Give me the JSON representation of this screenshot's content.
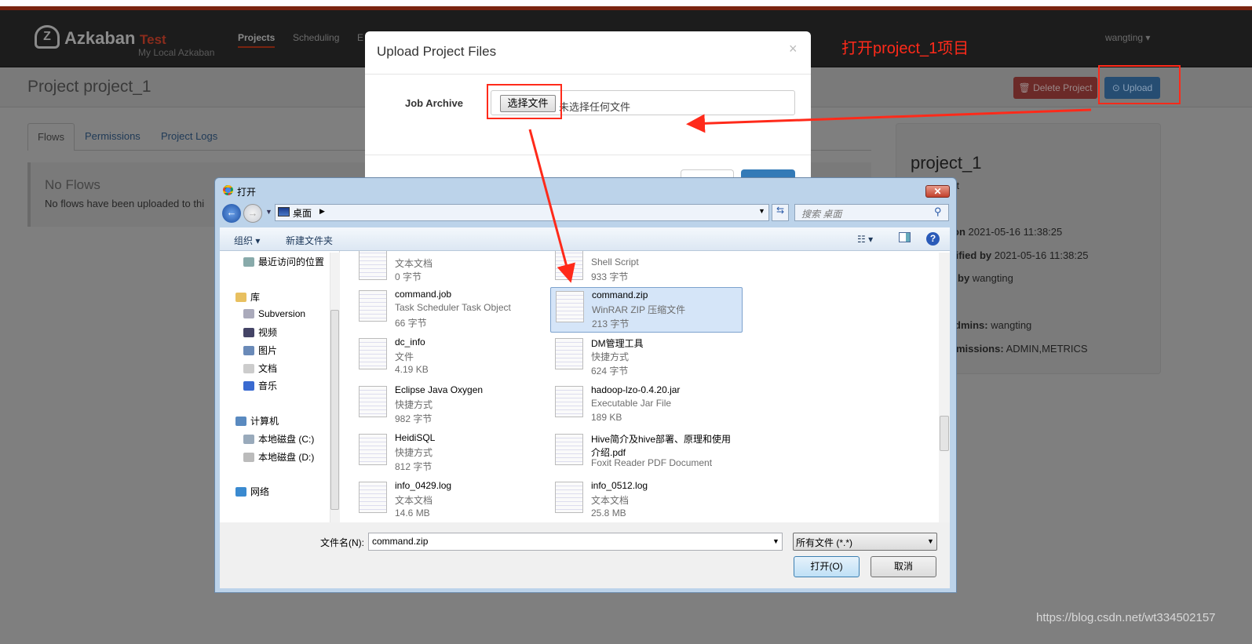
{
  "navbar": {
    "brand": "Azkaban",
    "env": "Test",
    "subtitle": "My Local Azkaban",
    "links": [
      "Projects",
      "Scheduling",
      "E"
    ],
    "user": "wangting"
  },
  "page": {
    "title": "Project project_1",
    "delete_label": "Delete Project",
    "upload_label": "Upload",
    "tabs": [
      "Flows",
      "Permissions",
      "Project Logs"
    ],
    "no_flows_title": "No Flows",
    "no_flows_text": "No flows have been uploaded to thi"
  },
  "sidebar": {
    "name": "project_1",
    "desc": "st",
    "lines": [
      {
        "k": "on",
        "v": " 2021-05-16 11:38:25"
      },
      {
        "k": "lified by",
        "v": " 2021-05-16 11:38:25"
      },
      {
        "k": "by",
        "v": " wangting"
      },
      {
        "k": "dmins:",
        "v": " wangting"
      },
      {
        "k": "missions:",
        "v": " ADMIN,METRICS"
      }
    ]
  },
  "modal": {
    "title": "Upload Project Files",
    "close": "×",
    "job_archive_label": "Job Archive",
    "choose_file": "选择文件",
    "no_file": "未选择任何文件"
  },
  "annotation": "打开project_1项目",
  "file_dialog": {
    "title": "打开",
    "close": "✕",
    "address": "桌面",
    "search_placeholder": "搜索 桌面",
    "toolbar": {
      "organize": "组织 ▾",
      "new_folder": "新建文件夹"
    },
    "nav": [
      {
        "label": "最近访问的位置",
        "color": "#8aa"
      },
      {
        "label": "库",
        "color": "#e8c060"
      },
      {
        "label": "Subversion",
        "color": "#aab"
      },
      {
        "label": "视频",
        "color": "#446"
      },
      {
        "label": "图片",
        "color": "#6a8ab8"
      },
      {
        "label": "文档",
        "color": "#ccc"
      },
      {
        "label": "音乐",
        "color": "#3a6ad0"
      },
      {
        "label": "计算机",
        "color": "#5a8ac0"
      },
      {
        "label": "本地磁盘 (C:)",
        "color": "#9ab"
      },
      {
        "label": "本地磁盘 (D:)",
        "color": "#bbb"
      },
      {
        "label": "网络",
        "color": "#3a8ad0"
      }
    ],
    "files": [
      {
        "name": "",
        "type": "文本文档",
        "size": "0 字节"
      },
      {
        "name": "",
        "type": "Shell Script",
        "size": "933 字节"
      },
      {
        "name": "command.job",
        "type": "Task Scheduler Task Object",
        "size": "66 字节"
      },
      {
        "name": "command.zip",
        "type": "WinRAR ZIP 压缩文件",
        "size": "213 字节",
        "selected": true
      },
      {
        "name": "dc_info",
        "type": "文件",
        "size": "4.19 KB"
      },
      {
        "name": "DM管理工具",
        "type": "快捷方式",
        "size": "624 字节"
      },
      {
        "name": "Eclipse Java Oxygen",
        "type": "快捷方式",
        "size": "982 字节"
      },
      {
        "name": "hadoop-lzo-0.4.20.jar",
        "type": "Executable Jar File",
        "size": "189 KB"
      },
      {
        "name": "HeidiSQL",
        "type": "快捷方式",
        "size": "812 字节"
      },
      {
        "name": "Hive简介及hive部署、原理和使用介绍.pdf",
        "type": "Foxit Reader PDF Document",
        "size": ""
      },
      {
        "name": "info_0429.log",
        "type": "文本文档",
        "size": "14.6 MB"
      },
      {
        "name": "info_0512.log",
        "type": "文本文档",
        "size": "25.8 MB"
      }
    ],
    "filename_label": "文件名(N):",
    "filename_value": "command.zip",
    "filetype": "所有文件 (*.*)",
    "open": "打开(O)",
    "cancel": "取消"
  },
  "watermark": "https://blog.csdn.net/wt334502157",
  "colors": {
    "annotation": "#ff2a1a",
    "upload_btn": "#337ab7",
    "delete_btn": "#d9534f",
    "brand_red": "#c0392b"
  }
}
